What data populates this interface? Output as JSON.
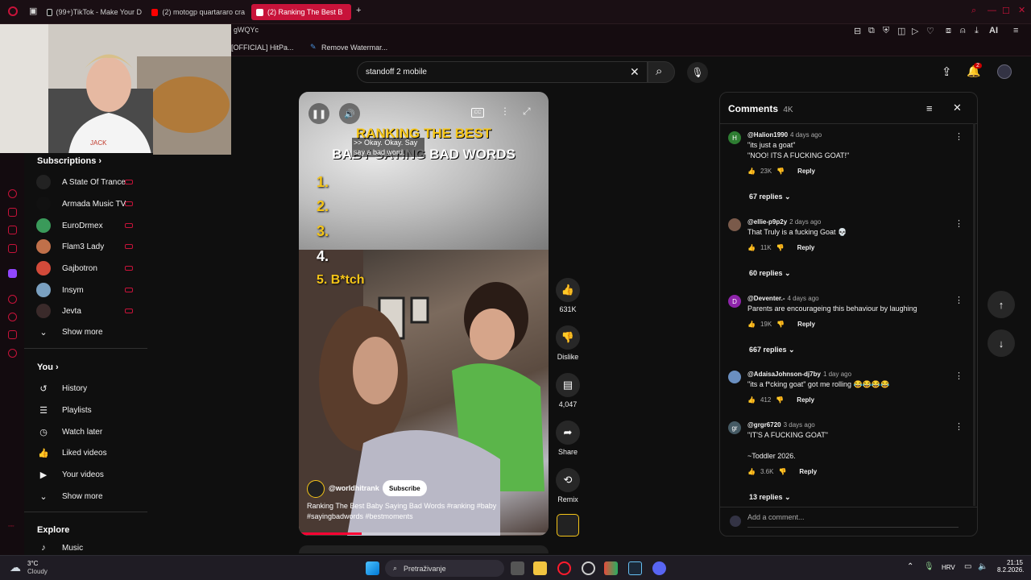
{
  "browser": {
    "tabs": [
      {
        "label": "(99+)TikTok - Make Your D",
        "color": "#2a2a2a"
      },
      {
        "label": "(2) motogp quartararo cra",
        "color": "#ff0000"
      },
      {
        "label": "(2) Ranking The Best B",
        "color": "#ff0000"
      }
    ],
    "url_fragment": "gWQYc",
    "bookmarks": [
      "[OFFICIAL] HitPa...",
      "Remove Watermar..."
    ],
    "ai_label": "AI"
  },
  "search": {
    "query": "standoff 2 mobile"
  },
  "header": {
    "notification_count": "2"
  },
  "sidebar": {
    "subscriptions_title": "Subscriptions",
    "subscriptions": [
      {
        "name": "A State Of Trance",
        "color": "#222"
      },
      {
        "name": "Armada Music TV",
        "color": "#111"
      },
      {
        "name": "EuroDrmex",
        "color": "#3a9a5a"
      },
      {
        "name": "Flam3 Lady",
        "color": "#c0704a"
      },
      {
        "name": "Gajbotron",
        "color": "#d24a3a"
      },
      {
        "name": "Insym",
        "color": "#7aa0c0"
      },
      {
        "name": "Jevta",
        "color": "#3a2a2a"
      }
    ],
    "show_more_1": "Show more",
    "you_title": "You",
    "you_items": [
      {
        "label": "History",
        "icon": "history-icon"
      },
      {
        "label": "Playlists",
        "icon": "playlists-icon"
      },
      {
        "label": "Watch later",
        "icon": "clock-icon"
      },
      {
        "label": "Liked videos",
        "icon": "thumbs-up-icon"
      },
      {
        "label": "Your videos",
        "icon": "video-icon"
      }
    ],
    "show_more_2": "Show more",
    "explore_title": "Explore",
    "explore_items": [
      {
        "label": "Music"
      }
    ]
  },
  "video": {
    "overlay_title_1": "RANKING THE BEST",
    "overlay_title_2": "BABY SAYING BAD WORDS",
    "caption": ">> Okay. Okay. Say say a bad word.",
    "ranks": [
      "1.",
      "2.",
      "3.",
      "4.",
      "5. B*tch"
    ],
    "channel": "@worldhitrank",
    "subscribe_label": "Subscribe",
    "description": "Ranking The Best Baby Saying Bad Words #ranking #baby #sayingbadwords #bestmoments",
    "progress": 0.25
  },
  "actions": {
    "likes": "631K",
    "dislike": "Dislike",
    "comments": "4,047",
    "share": "Share",
    "remix": "Remix"
  },
  "comments_panel": {
    "title": "Comments",
    "count": "4K",
    "add_placeholder": "Add a comment...",
    "reply_label": "Reply",
    "items": [
      {
        "avatar": "H",
        "avatar_color": "#2e7d32",
        "user": "@Halion1990",
        "ago": "4 days ago",
        "lines": [
          "\"its just a goat\"",
          "\"NOO! ITS A FUCKING GOAT!\""
        ],
        "likes": "23K",
        "replies": "67 replies"
      },
      {
        "avatar": "",
        "avatar_color": "#7a5a4a",
        "user": "@ellie-p9p2y",
        "ago": "2 days ago",
        "lines": [
          "That Truly is a fucking Goat 💀"
        ],
        "likes": "11K",
        "replies": "60 replies"
      },
      {
        "avatar": "D",
        "avatar_color": "#8e24aa",
        "user": "@Deventer.-",
        "ago": "4 days ago",
        "lines": [
          "Parents are encourageing this behaviour by laughing"
        ],
        "likes": "19K",
        "replies": "667 replies"
      },
      {
        "avatar": "",
        "avatar_color": "#6a8fc0",
        "user": "@AdaisaJohnson-dj7by",
        "ago": "1 day ago",
        "lines": [
          "\"its a f*cking goat\" got me rolling 😂😂😂😂"
        ],
        "likes": "412",
        "replies": ""
      },
      {
        "avatar": "gr",
        "avatar_color": "#455a64",
        "user": "@grgr6720",
        "ago": "3 days ago",
        "lines": [
          "\"IT'S A FUCKING GOAT\"",
          "",
          "~Toddler 2026."
        ],
        "likes": "3.6K",
        "replies": "13 replies"
      }
    ]
  },
  "taskbar": {
    "weather_temp": "3°C",
    "weather_desc": "Cloudy",
    "search_placeholder": "Pretraživanje",
    "lang": "HRV",
    "time": "21:15",
    "date": "8.2.2026."
  }
}
